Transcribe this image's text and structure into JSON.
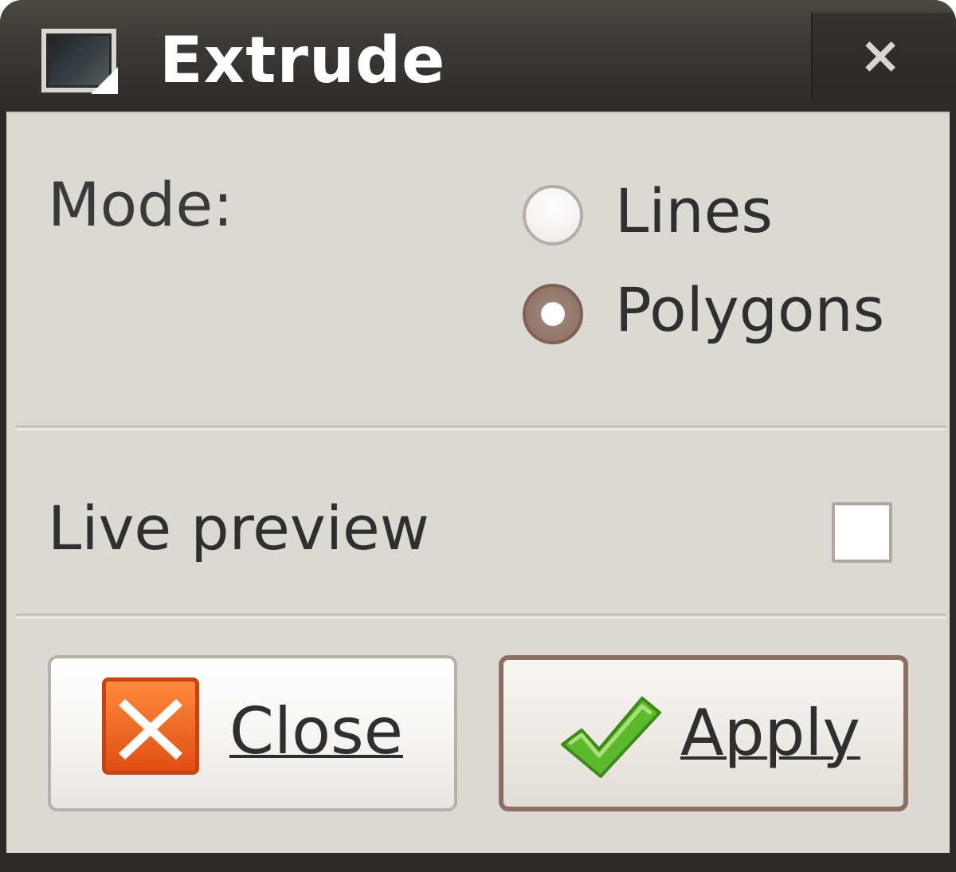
{
  "window": {
    "title": "Extrude",
    "app_icon": "window-icon",
    "close_icon": "close-icon",
    "close_glyph": "×"
  },
  "mode": {
    "label": "Mode:",
    "options": [
      {
        "label": "Lines",
        "selected": false
      },
      {
        "label": "Polygons",
        "selected": true
      }
    ]
  },
  "live_preview": {
    "label": "Live preview",
    "checked": false
  },
  "buttons": {
    "close": {
      "label": "Close",
      "icon": "close-x-icon",
      "color": "#f06a1f"
    },
    "apply": {
      "label": "Apply",
      "icon": "checkmark-icon",
      "color": "#5cb82d"
    }
  }
}
